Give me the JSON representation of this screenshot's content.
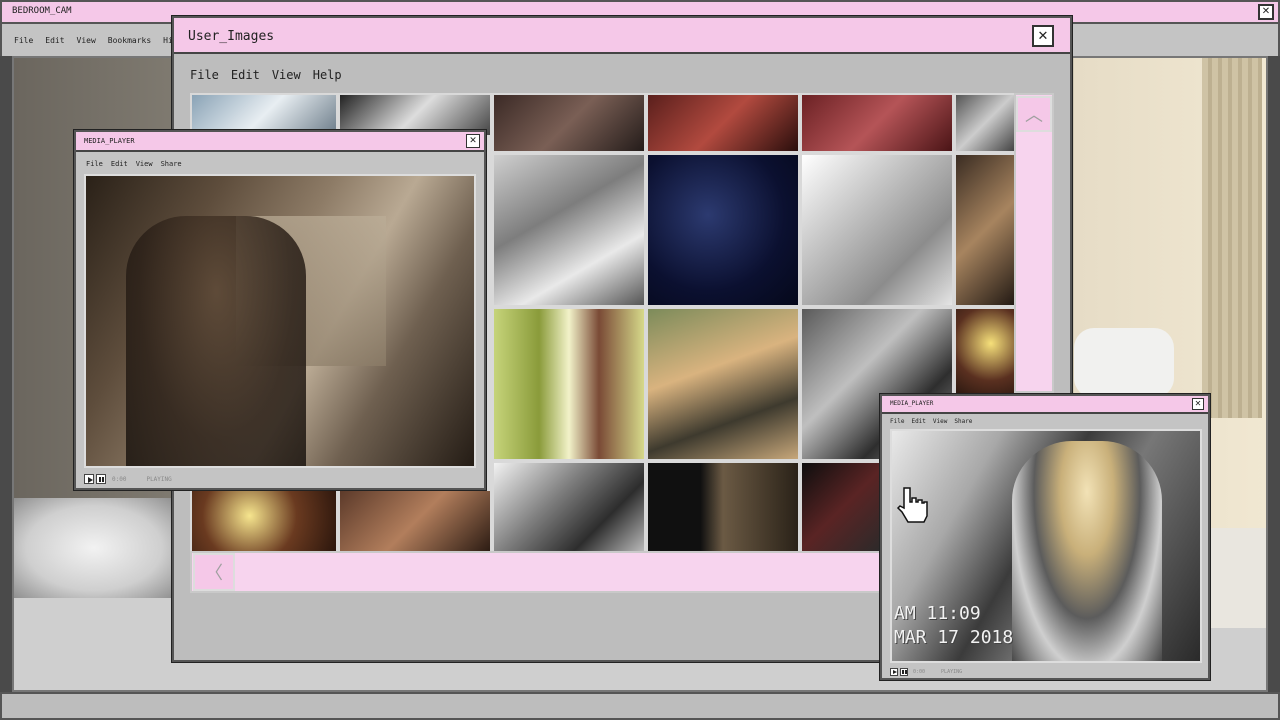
{
  "outer_window": {
    "title": "BEDROOM_CAM",
    "menu": [
      "File",
      "Edit",
      "View",
      "Bookmarks",
      "Histor"
    ],
    "close_symbol": "✕"
  },
  "images_window": {
    "title": "User_Images",
    "menu": [
      "File",
      "Edit",
      "View",
      "Help"
    ],
    "close_symbol": "✕",
    "scroll_up_symbol": "︿",
    "scroll_left_symbol": "〈"
  },
  "media_player_left": {
    "title": "MEDIA_PLAYER",
    "menu": [
      "File",
      "Edit",
      "View",
      "Share"
    ],
    "close_symbol": "✕",
    "time": "0:00",
    "status": "PLAYING"
  },
  "media_player_right": {
    "title": "MEDIA_PLAYER",
    "menu": [
      "File",
      "Edit",
      "View",
      "Share"
    ],
    "close_symbol": "✕",
    "time": "0:00",
    "status": "PLAYING",
    "timestamp_line1": "AM 11:09",
    "timestamp_line2": "MAR 17 2018"
  },
  "colors": {
    "title_bar": "#f5c8e8",
    "window_bg": "#bdbdbd",
    "scroll_track": "#f7d4ee"
  },
  "icons": {
    "cursor": "hand-pointer-icon",
    "play": "play-icon",
    "pause": "pause-icon"
  }
}
